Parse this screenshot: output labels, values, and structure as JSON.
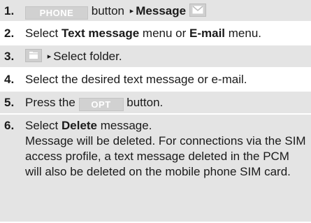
{
  "steps": [
    {
      "number": "1.",
      "key_label": "PHONE",
      "text_after_key": "button",
      "arrow": "▸",
      "bold": "Message",
      "icon": "envelope-icon"
    },
    {
      "number": "2.",
      "pre": "Select ",
      "bold1": "Text message",
      "mid": " menu or ",
      "bold2": "E-mail",
      "post": " menu."
    },
    {
      "number": "3.",
      "icon": "folder-icon",
      "arrow": "▸",
      "text": "Select folder."
    },
    {
      "number": "4.",
      "text": "Select the desired text message or e-mail."
    },
    {
      "number": "5.",
      "pre": "Press the ",
      "key_label": "OPT",
      "post": " button."
    },
    {
      "number": "6.",
      "pre": "Select ",
      "bold": "Delete",
      "post": " message.",
      "note": "Message will be deleted. For connections via the SIM access profile, a text message deleted in the PCM will also be deleted on the mobile phone SIM card."
    }
  ],
  "colors": {
    "shaded_row": "#e4e4e4",
    "key_background": "#d1d1d1",
    "key_text": "#ffffff"
  }
}
